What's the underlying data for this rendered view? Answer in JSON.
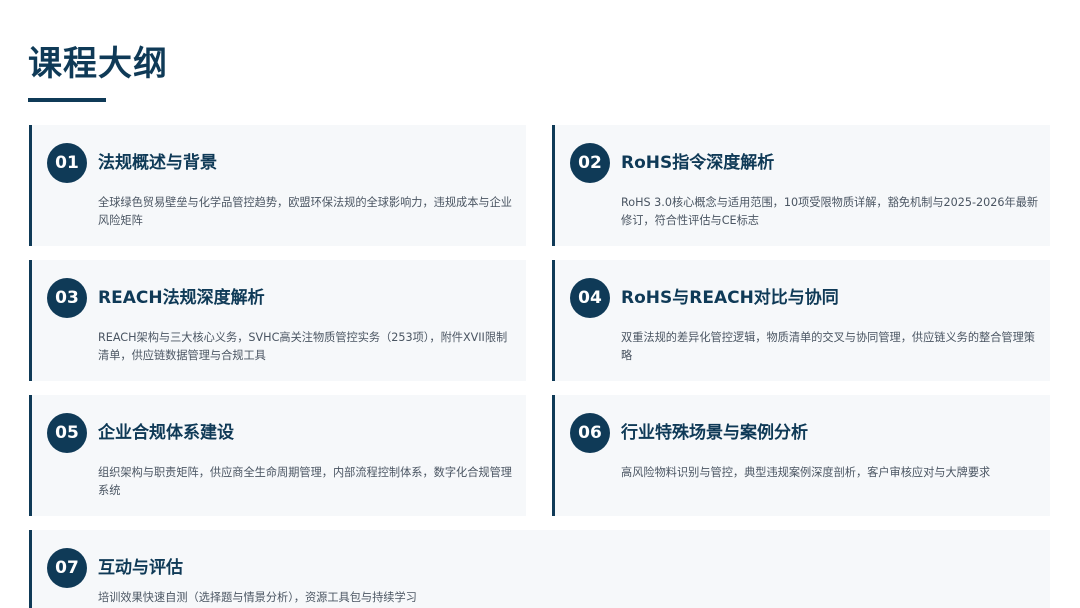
{
  "page": {
    "title": "课程大纲"
  },
  "modules": [
    {
      "number": "01",
      "title": "法规概述与背景",
      "description": "全球绿色贸易壁垒与化学品管控趋势，欧盟环保法规的全球影响力，违规成本与企业风险矩阵"
    },
    {
      "number": "02",
      "title": "RoHS指令深度解析",
      "description": "RoHS 3.0核心概念与适用范围，10项受限物质详解，豁免机制与2025-2026年最新修订，符合性评估与CE标志"
    },
    {
      "number": "03",
      "title": "REACH法规深度解析",
      "description": "REACH架构与三大核心义务，SVHC高关注物质管控实务（253项），附件XVII限制清单，供应链数据管理与合规工具"
    },
    {
      "number": "04",
      "title": "RoHS与REACH对比与协同",
      "description": "双重法规的差异化管控逻辑，物质清单的交叉与协同管理，供应链义务的整合管理策略"
    },
    {
      "number": "05",
      "title": "企业合规体系建设",
      "description": "组织架构与职责矩阵，供应商全生命周期管理，内部流程控制体系，数字化合规管理系统"
    },
    {
      "number": "06",
      "title": "行业特殊场景与案例分析",
      "description": "高风险物料识别与管控，典型违规案例深度剖析，客户审核应对与大牌要求"
    },
    {
      "number": "07",
      "title": "互动与评估",
      "description": "培训效果快速自测（选择题与情景分析），资源工具包与持续学习"
    }
  ],
  "colors": {
    "primary": "#0f3a57",
    "card_background": "#f6f8fa",
    "body_text": "#4a5562"
  }
}
